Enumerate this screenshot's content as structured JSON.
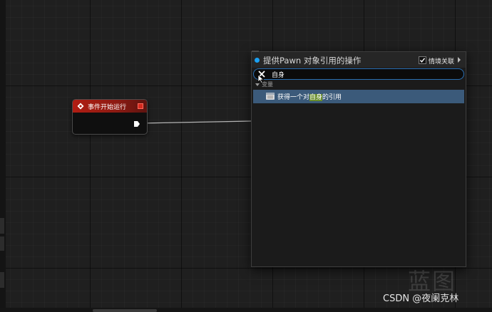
{
  "graph": {
    "event_node": {
      "title": "事件开始运行",
      "header_color": "#b11d13"
    },
    "watermark": "蓝图"
  },
  "context_menu": {
    "title": "提供Pawn 对象引用的操作",
    "context_sensitive": {
      "label": "情境关联",
      "checked": true
    },
    "search": {
      "value": "自身"
    },
    "category_label": "变量",
    "result": {
      "prefix": "获得一个对",
      "highlight": "自身",
      "suffix": "的引用"
    }
  },
  "credit": "CSDN @夜阑克林",
  "colors": {
    "accent_blue": "#1aa0f2",
    "selection": "#3b5a7a",
    "match_highlight": "#6a8e2c"
  }
}
